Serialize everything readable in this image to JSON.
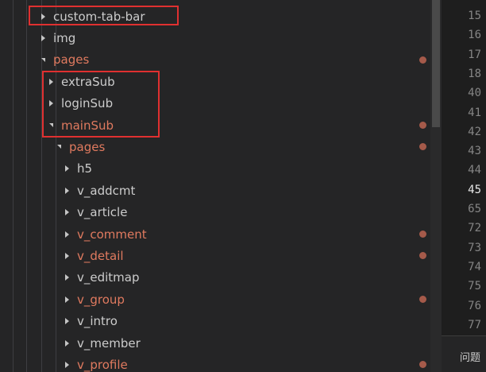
{
  "explorer": {
    "items": [
      {
        "label": "custom-tab-bar",
        "expanded": false,
        "modified": false,
        "indent": 0
      },
      {
        "label": "img",
        "expanded": false,
        "modified": false,
        "indent": 0
      },
      {
        "label": "pages",
        "expanded": true,
        "modified": true,
        "indent": 0
      },
      {
        "label": "extraSub",
        "expanded": false,
        "modified": false,
        "indent": 1
      },
      {
        "label": "loginSub",
        "expanded": false,
        "modified": false,
        "indent": 1
      },
      {
        "label": "mainSub",
        "expanded": true,
        "modified": true,
        "indent": 1
      },
      {
        "label": "pages",
        "expanded": true,
        "modified": true,
        "indent": 2
      },
      {
        "label": "h5",
        "expanded": false,
        "modified": false,
        "indent": 3
      },
      {
        "label": "v_addcmt",
        "expanded": false,
        "modified": false,
        "indent": 3
      },
      {
        "label": "v_article",
        "expanded": false,
        "modified": false,
        "indent": 3
      },
      {
        "label": "v_comment",
        "expanded": false,
        "modified": true,
        "indent": 3
      },
      {
        "label": "v_detail",
        "expanded": false,
        "modified": true,
        "indent": 3
      },
      {
        "label": "v_editmap",
        "expanded": false,
        "modified": false,
        "indent": 3
      },
      {
        "label": "v_group",
        "expanded": false,
        "modified": true,
        "indent": 3
      },
      {
        "label": "v_intro",
        "expanded": false,
        "modified": false,
        "indent": 3
      },
      {
        "label": "v_member",
        "expanded": false,
        "modified": false,
        "indent": 3
      },
      {
        "label": "v_profile",
        "expanded": false,
        "modified": true,
        "indent": 3
      }
    ]
  },
  "editor": {
    "line_numbers": [
      "15",
      "16",
      "17",
      "18",
      "40",
      "41",
      "42",
      "43",
      "44",
      "45",
      "65",
      "72",
      "73",
      "74",
      "75",
      "76",
      "77"
    ],
    "active_line": "45"
  },
  "panel": {
    "tab_label": "问题"
  },
  "colors": {
    "modified": "#e07a5f",
    "highlight": "#e03030",
    "background": "#252526"
  }
}
